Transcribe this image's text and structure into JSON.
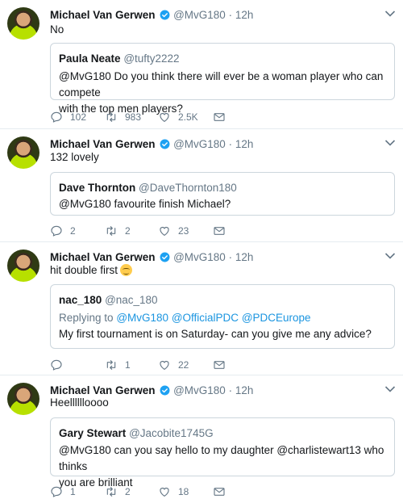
{
  "author": {
    "name": "Michael Van Gerwen",
    "handle": "@MvG180",
    "separator": "·",
    "time": "12h"
  },
  "colors": {
    "verified": "#1da1f2",
    "muted": "#657786",
    "link": "#1b95e0",
    "border": "#ccd6dd"
  },
  "tweets": [
    {
      "text": "No",
      "quote": {
        "name": "Paula Neate",
        "handle": "@tufty2222",
        "line1": "@MvG180 Do you think there will ever be a woman player who can compete",
        "line2": "with the top men players?"
      },
      "counts": {
        "reply": "102",
        "retweet": "983",
        "like": "2.5K"
      }
    },
    {
      "text": "132 lovely",
      "quote": {
        "name": "Dave Thornton",
        "handle": "@DaveThornton180",
        "line1": "@MvG180 favourite finish Michael?"
      },
      "counts": {
        "reply": "2",
        "retweet": "2",
        "like": "23"
      }
    },
    {
      "text": "hit double first",
      "emoji": "smiling-face-emoji",
      "quote": {
        "name": "nac_180",
        "handle": "@nac_180",
        "replying_prefix": "Replying to",
        "replying_to": [
          "@MvG180",
          "@OfficialPDC",
          "@PDCEurope"
        ],
        "line1": "My first tournament is on Saturday- can you give me any advice?"
      },
      "counts": {
        "reply": "",
        "retweet": "1",
        "like": "22"
      }
    },
    {
      "text": "Heelllllloooo",
      "quote": {
        "name": "Gary Stewart",
        "handle": "@Jacobite1745G",
        "line1": "@MvG180 can you say hello to my daughter @charlistewart13 who thinks",
        "line2": "you are brilliant"
      },
      "counts": {
        "reply": "1",
        "retweet": "2",
        "like": "18"
      }
    }
  ]
}
